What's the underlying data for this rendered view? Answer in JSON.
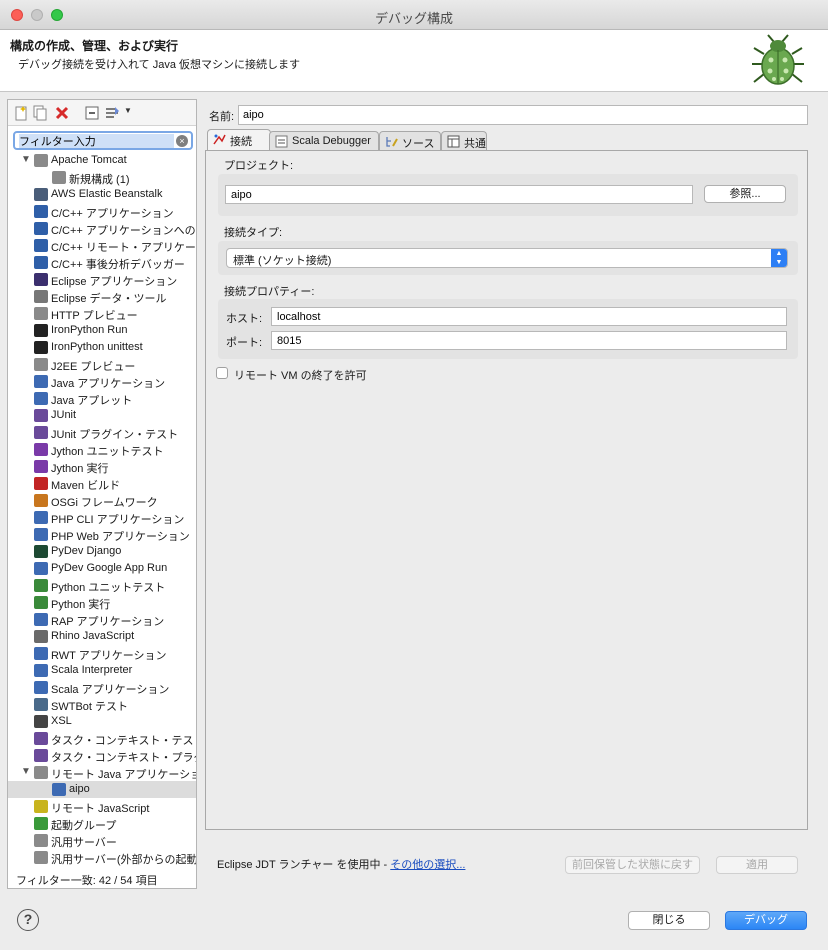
{
  "window": {
    "title": "デバッグ構成"
  },
  "header": {
    "title": "構成の作成、管理、および実行",
    "subtitle": "デバッグ接続を受け入れて Java 仮想マシンに接続します"
  },
  "filter": {
    "value": "フィルター入力"
  },
  "tree": [
    {
      "label": "Apache Tomcat",
      "icon": "tomcat-icon",
      "color": "#8a8a8a",
      "level": 0,
      "twisty": "▼"
    },
    {
      "label": "新規構成 (1)",
      "icon": "tomcat-config-icon",
      "color": "#8a8a8a",
      "level": 1
    },
    {
      "label": "AWS Elastic Beanstalk",
      "icon": "aws-icon",
      "color": "#4a5d79",
      "level": 0
    },
    {
      "label": "C/C++ アプリケーション",
      "icon": "c-app-icon",
      "color": "#2f5fa8",
      "level": 0
    },
    {
      "label": "C/C++ アプリケーションへの接",
      "icon": "c-attach-icon",
      "color": "#2f5fa8",
      "level": 0
    },
    {
      "label": "C/C++ リモート・アプリケー:",
      "icon": "c-remote-icon",
      "color": "#2f5fa8",
      "level": 0
    },
    {
      "label": "C/C++ 事後分析デバッガー",
      "icon": "c-postmortem-icon",
      "color": "#2f5fa8",
      "level": 0
    },
    {
      "label": "Eclipse アプリケーション",
      "icon": "eclipse-icon",
      "color": "#3b2f6e",
      "level": 0
    },
    {
      "label": "Eclipse データ・ツール",
      "icon": "database-icon",
      "color": "#777777",
      "level": 0
    },
    {
      "label": "HTTP プレビュー",
      "icon": "http-preview-icon",
      "color": "#8a8a8a",
      "level": 0
    },
    {
      "label": "IronPython Run",
      "icon": "ironpython-run-icon",
      "color": "#222222",
      "level": 0
    },
    {
      "label": "IronPython unittest",
      "icon": "ironpython-unittest-icon",
      "color": "#222222",
      "level": 0
    },
    {
      "label": "J2EE プレビュー",
      "icon": "j2ee-icon",
      "color": "#8a8a8a",
      "level": 0
    },
    {
      "label": "Java アプリケーション",
      "icon": "java-app-icon",
      "color": "#3d6ab3",
      "level": 0
    },
    {
      "label": "Java アプレット",
      "icon": "java-applet-icon",
      "color": "#3d6ab3",
      "level": 0
    },
    {
      "label": "JUnit",
      "icon": "junit-icon",
      "color": "#6a4a9a",
      "level": 0
    },
    {
      "label": "JUnit プラグイン・テスト",
      "icon": "junit-plugin-icon",
      "color": "#6a4a9a",
      "level": 0
    },
    {
      "label": "Jython ユニットテスト",
      "icon": "jython-unittest-icon",
      "color": "#7a3aa8",
      "level": 0
    },
    {
      "label": "Jython 実行",
      "icon": "jython-run-icon",
      "color": "#7a3aa8",
      "level": 0
    },
    {
      "label": "Maven ビルド",
      "icon": "maven-icon",
      "color": "#c22525",
      "level": 0
    },
    {
      "label": "OSGi フレームワーク",
      "icon": "osgi-icon",
      "color": "#c8761e",
      "level": 0
    },
    {
      "label": "PHP CLI アプリケーション",
      "icon": "php-cli-icon",
      "color": "#3d6ab3",
      "level": 0
    },
    {
      "label": "PHP Web アプリケーション",
      "icon": "php-web-icon",
      "color": "#3d6ab3",
      "level": 0
    },
    {
      "label": "PyDev Django",
      "icon": "django-icon",
      "color": "#1d4a33",
      "level": 0
    },
    {
      "label": "PyDev Google App Run",
      "icon": "google-app-icon",
      "color": "#3d6ab3",
      "level": 0
    },
    {
      "label": "Python ユニットテスト",
      "icon": "python-unittest-icon",
      "color": "#3a8a3a",
      "level": 0
    },
    {
      "label": "Python 実行",
      "icon": "python-run-icon",
      "color": "#3a8a3a",
      "level": 0
    },
    {
      "label": "RAP アプリケーション",
      "icon": "rap-icon",
      "color": "#3d6ab3",
      "level": 0
    },
    {
      "label": "Rhino JavaScript",
      "icon": "rhino-icon",
      "color": "#6a6a6a",
      "level": 0
    },
    {
      "label": "RWT アプリケーション",
      "icon": "rwt-icon",
      "color": "#3d6ab3",
      "level": 0
    },
    {
      "label": "Scala Interpreter",
      "icon": "scala-interpreter-icon",
      "color": "#3d6ab3",
      "level": 0
    },
    {
      "label": "Scala アプリケーション",
      "icon": "scala-app-icon",
      "color": "#3d6ab3",
      "level": 0
    },
    {
      "label": "SWTBot テスト",
      "icon": "swtbot-icon",
      "color": "#4a6a8a",
      "level": 0
    },
    {
      "label": "XSL",
      "icon": "xsl-icon",
      "color": "#444444",
      "level": 0
    },
    {
      "label": "タスク・コンテキスト・テスト",
      "icon": "task-context-test-icon",
      "color": "#6a4a9a",
      "level": 0
    },
    {
      "label": "タスク・コンテキスト・プラグ",
      "icon": "task-context-plugin-icon",
      "color": "#6a4a9a",
      "level": 0
    },
    {
      "label": "リモート Java アプリケーショ",
      "icon": "remote-java-icon",
      "color": "#8a8a8a",
      "level": 0,
      "twisty": "▼"
    },
    {
      "label": "aipo",
      "icon": "remote-java-config-icon",
      "color": "#3d6ab3",
      "level": 1,
      "selected": true
    },
    {
      "label": "リモート JavaScript",
      "icon": "remote-javascript-icon",
      "color": "#c8b41e",
      "level": 0
    },
    {
      "label": "起動グループ",
      "icon": "launch-group-icon",
      "color": "#3a9a3a",
      "level": 0
    },
    {
      "label": "汎用サーバー",
      "icon": "generic-server-icon",
      "color": "#8a8a8a",
      "level": 0
    },
    {
      "label": "汎用サーバー(外部からの起動)",
      "icon": "generic-server-external-icon",
      "color": "#8a8a8a",
      "level": 0
    }
  ],
  "filter_status": "フィルター一致: 42 / 54 項目",
  "name": {
    "label": "名前:",
    "value": "aipo"
  },
  "tabs": [
    {
      "label": "接続",
      "icon": "connect-icon",
      "active": true
    },
    {
      "label": "Scala Debugger",
      "icon": "scala-debugger-icon",
      "active": false
    },
    {
      "label": "ソース",
      "icon": "source-icon",
      "active": false
    },
    {
      "label": "共通",
      "icon": "common-icon",
      "active": false
    }
  ],
  "connect": {
    "project_label": "プロジェクト:",
    "project_value": "aipo",
    "browse_label": "参照...",
    "type_label": "接続タイプ:",
    "type_value": "標準 (ソケット接続)",
    "props_label": "接続プロパティー:",
    "host_label": "ホスト:",
    "host_value": "localhost",
    "port_label": "ポート:",
    "port_value": "8015",
    "allow_terminate_label": "リモート VM の終了を許可"
  },
  "launcher": {
    "text": "Eclipse JDT ランチャー を使用中 - ",
    "link": "その他の選択..."
  },
  "buttons": {
    "revert": "前回保管した状態に戻す",
    "apply": "適用",
    "close": "閉じる",
    "debug": "デバッグ"
  },
  "colors": {
    "accent": "#2b86f5",
    "link": "#1a4dbf"
  }
}
